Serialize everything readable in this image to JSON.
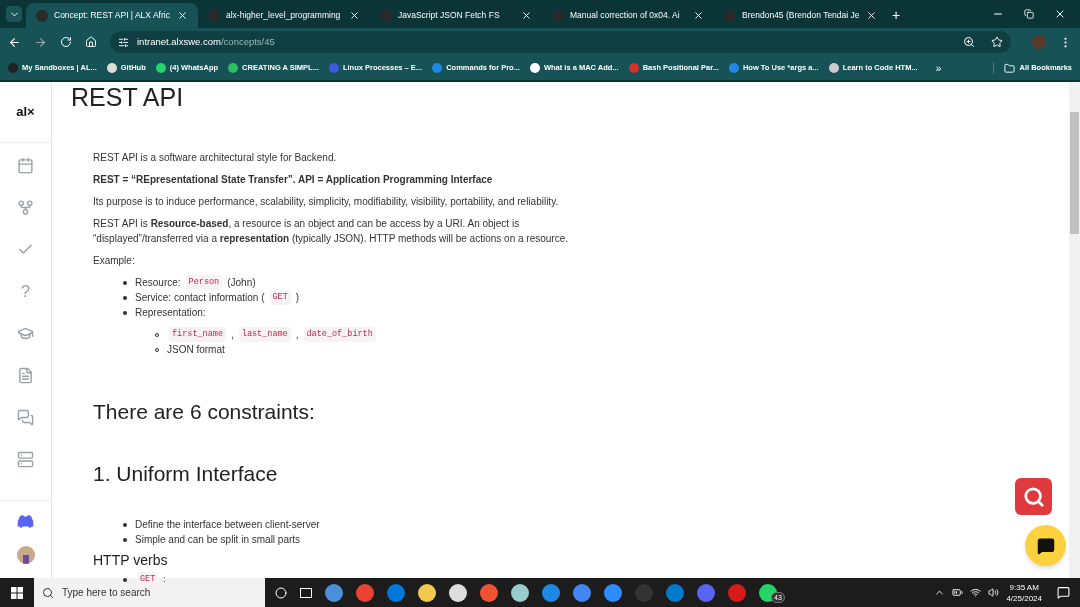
{
  "browser": {
    "tabs": [
      {
        "title": "Concept: REST API | ALX Afric",
        "selected": true
      },
      {
        "title": "alx-higher_level_programming",
        "selected": false
      },
      {
        "title": "JavaScript JSON Fetch FS",
        "selected": false
      },
      {
        "title": "Manual correction of 0x04. Ai",
        "selected": false
      },
      {
        "title": "Brendon45 (Brendon Tendai Je",
        "selected": false
      }
    ],
    "new_tab": "+",
    "address": {
      "host": "intranet.alxswe.com",
      "path": "/concepts/45"
    },
    "bookmarks": [
      "My Sandboxes | AL...",
      "GitHub",
      "(4) WhatsApp",
      "CREATING A SIMPL...",
      "Linux Processes – E...",
      "Commands for Pro...",
      "What is a MAC Add...",
      "Bash Positional Par...",
      "How To Use *args a...",
      "Learn to Code HTM..."
    ],
    "more": "»",
    "all_bookmarks": "All Bookmarks"
  },
  "sidebar": {
    "logo": "al×",
    "help_glyph": "?"
  },
  "article": {
    "title": "REST API",
    "paragraphs": [
      {
        "kind": "text",
        "text": "REST API is a software architectural style for Backend."
      },
      {
        "kind": "bold",
        "text": "REST = “REpresentational State Transfer”. API = Application Programming Interface"
      },
      {
        "kind": "text",
        "text": "Its purpose is to induce performance, scalability, simplicity, modifiability, visibility, portability, and reliability."
      },
      {
        "kind": "text",
        "text": "REST API is **Resource-based**, a resource is an object and can be access by a URI. An object is “displayed”/transferred via a **representation** (typically JSON). HTTP methods will be actions on a resource."
      },
      {
        "kind": "text",
        "text": "Example:"
      }
    ],
    "example_list": [
      {
        "parts": [
          {
            "kind": "text",
            "text": "Resource:"
          },
          {
            "kind": "code",
            "text": "Person"
          },
          {
            "kind": "text",
            "text": "(John)"
          }
        ]
      },
      {
        "parts": [
          {
            "kind": "text",
            "text": "Service: contact information ("
          },
          {
            "kind": "code",
            "text": "GET"
          },
          {
            "kind": "text",
            "text": ")"
          }
        ]
      },
      {
        "parts": [
          {
            "kind": "text",
            "text": "Representation:"
          }
        ],
        "children": [
          {
            "parts": [
              {
                "kind": "code",
                "text": "first_name"
              },
              {
                "kind": "text",
                "text": ","
              },
              {
                "kind": "code",
                "text": "last_name"
              },
              {
                "kind": "text",
                "text": ","
              },
              {
                "kind": "code",
                "text": "date_of_birth"
              }
            ]
          },
          {
            "parts": [
              {
                "kind": "text",
                "text": "JSON format"
              }
            ]
          }
        ]
      }
    ],
    "heading_constraints": "There are 6 constraints:",
    "heading_uniform": "1. Uniform Interface",
    "uniform_list": [
      "Define the interface between client-server",
      "Simple and can be split in small parts"
    ],
    "subheading": "HTTP verbs",
    "verbs_list": [
      {
        "parts": [
          {
            "kind": "code",
            "text": "GET"
          },
          {
            "kind": "text",
            "text": ":"
          }
        ]
      }
    ]
  },
  "taskbar": {
    "search_placeholder": "Type here to search",
    "whatsapp_badge": "43",
    "time": "9:35 AM",
    "date": "4/25/2024"
  }
}
